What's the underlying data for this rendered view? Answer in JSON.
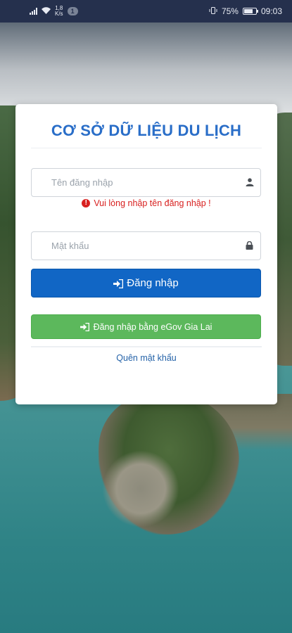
{
  "status_bar": {
    "speed_top": "1,8",
    "speed_bottom": "K/s",
    "notification_count": "1",
    "battery_percent": "75%",
    "battery_level": 0.75,
    "time": "09:03"
  },
  "login": {
    "title": "CƠ SỞ DỮ LIỆU DU LỊCH",
    "username_placeholder": "Tên đăng nhập",
    "username_value": "",
    "error_message": "Vui lòng nhập tên đăng nhập !",
    "password_placeholder": "Mật khẩu",
    "password_value": "",
    "login_button": "Đăng nhập",
    "egov_button": "Đăng nhập bằng eGov Gia Lai",
    "forgot_password": "Quên mật khẩu"
  },
  "colors": {
    "title": "#2a6ec8",
    "primary_button": "#1166c5",
    "success_button": "#5cb85c",
    "error": "#d8201f",
    "link": "#2462a8",
    "status_bar": "#25304d"
  },
  "icons": {
    "username": "user-icon",
    "password": "lock-icon",
    "error": "exclamation-circle-icon",
    "login": "sign-in-icon"
  }
}
